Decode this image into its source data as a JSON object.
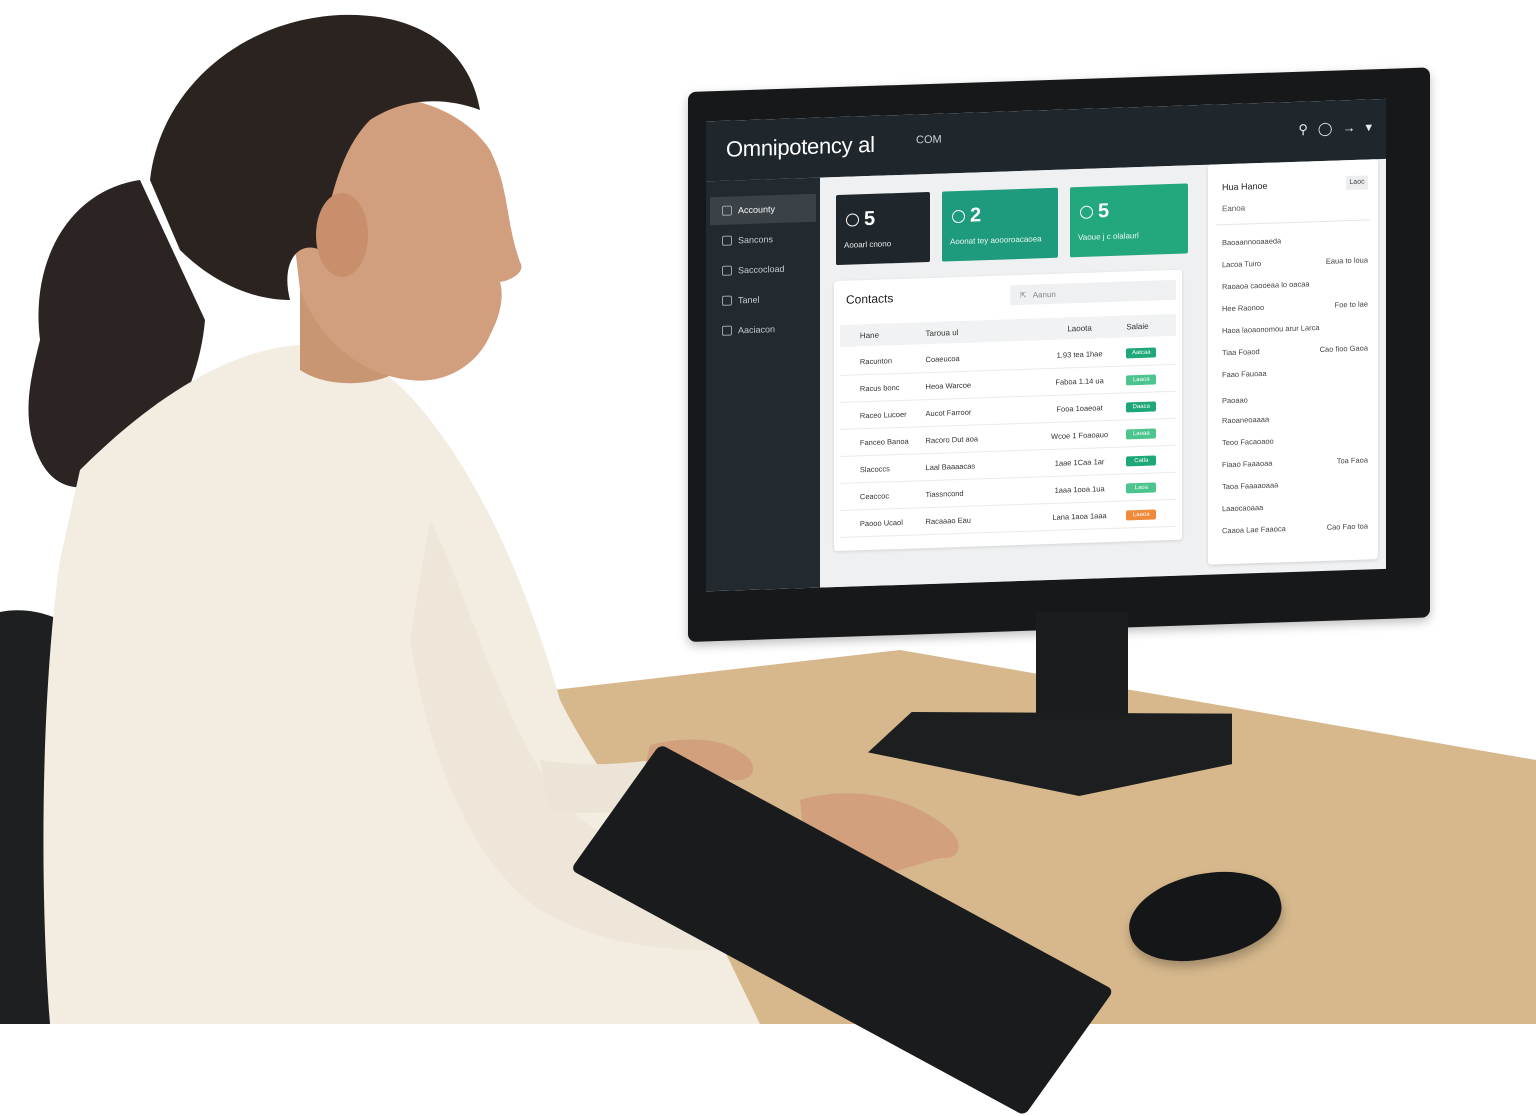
{
  "app": {
    "title": "Omnipotency al",
    "subtitle": "COM",
    "top_icons": [
      "search-icon",
      "help-icon",
      "settings-icon",
      "chevron-down-icon"
    ]
  },
  "sidebar": {
    "items": [
      {
        "label": "Accounty",
        "icon": "home-icon",
        "active": true
      },
      {
        "label": "Sancons",
        "icon": "file-icon",
        "active": false
      },
      {
        "label": "Saccocload",
        "icon": "folder-icon",
        "active": false
      },
      {
        "label": "Tanel",
        "icon": "doc-icon",
        "active": false
      },
      {
        "label": "Aaciacon",
        "icon": "doc-icon",
        "active": false
      }
    ]
  },
  "cards": [
    {
      "value": "5",
      "label": "Aooarl cnono",
      "color": "#1f272c"
    },
    {
      "value": "2",
      "label": "Aoonat tey aoooroacaoea",
      "color": "#1e9b7c"
    },
    {
      "value": "5",
      "label": "Vaoue j c olalaurl",
      "color": "#23a77e"
    }
  ],
  "contacts": {
    "title": "Contacts",
    "search_placeholder": "Aanun",
    "columns": [
      "Hane",
      "Taroua ul",
      "Laoota",
      "Salaie"
    ],
    "rows": [
      {
        "num": "",
        "name": "Racunton",
        "org": "Coaeucoa",
        "date": "1.93 tea 1hae",
        "status": "Aatcaa",
        "status_color": "#1fa877"
      },
      {
        "num": "",
        "name": "Racus bonc",
        "org": "Heoa Warcoe",
        "date": "Faboa 1.14 ua",
        "status": "Laaoa",
        "status_color": "#4cc48e"
      },
      {
        "num": "",
        "name": "Raceo Lucoer",
        "org": "Aucot Farroor",
        "date": "Fooa 1oaeoat",
        "status": "Daaca",
        "status_color": "#1fa877"
      },
      {
        "num": "",
        "name": "Fanceo Banoa",
        "org": "Racoro Dut aoa",
        "date": "Wcoe 1 Foaoauo",
        "status": "Laoaa",
        "status_color": "#4cc48e"
      },
      {
        "num": "",
        "name": "Slacoccs",
        "org": "Laal Baaaacas",
        "date": "1aae 1Caa 1ar",
        "status": "Catla",
        "status_color": "#1fa877"
      },
      {
        "num": "",
        "name": "Ceaccoc",
        "org": "Tiassncond",
        "date": "1aaa 1ooa 1ua",
        "status": "Laoa",
        "status_color": "#4cc48e"
      },
      {
        "num": "",
        "name": "Paooo Ucaol",
        "org": "Racaaao Eau",
        "date": "Lana 1aoa 1aaa",
        "status": "Laaoa",
        "status_color": "#ef8a3b"
      }
    ]
  },
  "right_panel": {
    "header": "Hua Hanoe",
    "button": "Laoc",
    "sub": "Eanoa",
    "section1": [
      {
        "left": "Baoaannooaaeda",
        "right": ""
      },
      {
        "left": "Lacoa Tuiro",
        "right": "Eaua to loua"
      },
      {
        "left": "Raoaoa caooeaa lo oacaa",
        "right": ""
      },
      {
        "left": "Hee Raonoo",
        "right": "Foe to lae"
      },
      {
        "left": "Haoa laoaonomou arur Larca",
        "right": ""
      },
      {
        "left": "Tiaa Foaod",
        "right": "Cao fioo Gaoa"
      },
      {
        "left": "Faao Fauoaa",
        "right": ""
      }
    ],
    "section2_title": "Paoaao",
    "section2": [
      {
        "left": "Raoaneoaaaa",
        "right": ""
      },
      {
        "left": "Teoo Facaoaoo",
        "right": ""
      },
      {
        "left": "Fiaao Faaaoaa",
        "right": "Toa Faoa"
      },
      {
        "left": "Taoa Faaaaoaaa",
        "right": ""
      },
      {
        "left": "Laaocaoaaa",
        "right": ""
      },
      {
        "left": "Caaoa Lae Faaoca",
        "right": "Cao Fao toa"
      }
    ]
  }
}
